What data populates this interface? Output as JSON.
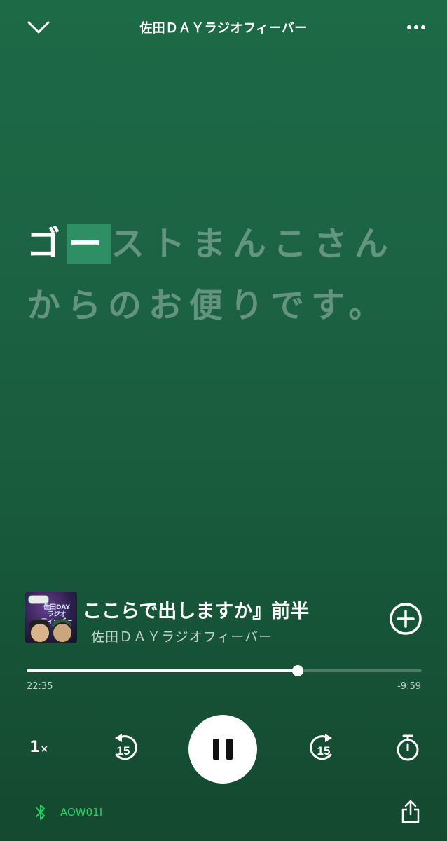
{
  "header": {
    "title": "佐田ＤＡＹラジオフィーバー",
    "collapse_icon": "chevron-down-icon",
    "more_icon": "more-dots-icon"
  },
  "lyrics": {
    "sung": "ゴ",
    "current": "ー",
    "unsung": "ストまんこさんからのお便りです。"
  },
  "now_playing": {
    "artwork_text": "佐田DAY\nラジオ\nフィーバー",
    "track_title": "ここらで出しますか』前半",
    "show_name": "佐田ＤＡＹラジオフィーバー",
    "add_icon": "plus-circle-icon"
  },
  "progress": {
    "elapsed": "22:35",
    "remaining": "-9:59",
    "fraction": 0.686
  },
  "controls": {
    "speed_value": "1",
    "speed_suffix": "×",
    "skip_back_seconds": "15",
    "skip_forward_seconds": "15",
    "play_state": "pause",
    "timer_icon": "sleep-timer-icon"
  },
  "footer": {
    "device_name": "AOW01I",
    "bluetooth_icon": "bluetooth-icon",
    "share_icon": "share-icon"
  },
  "colors": {
    "background_top": "#1d6a47",
    "background_bottom": "#14492f",
    "lyric_highlight": "#2d8f63",
    "device_green": "#1ed760"
  }
}
